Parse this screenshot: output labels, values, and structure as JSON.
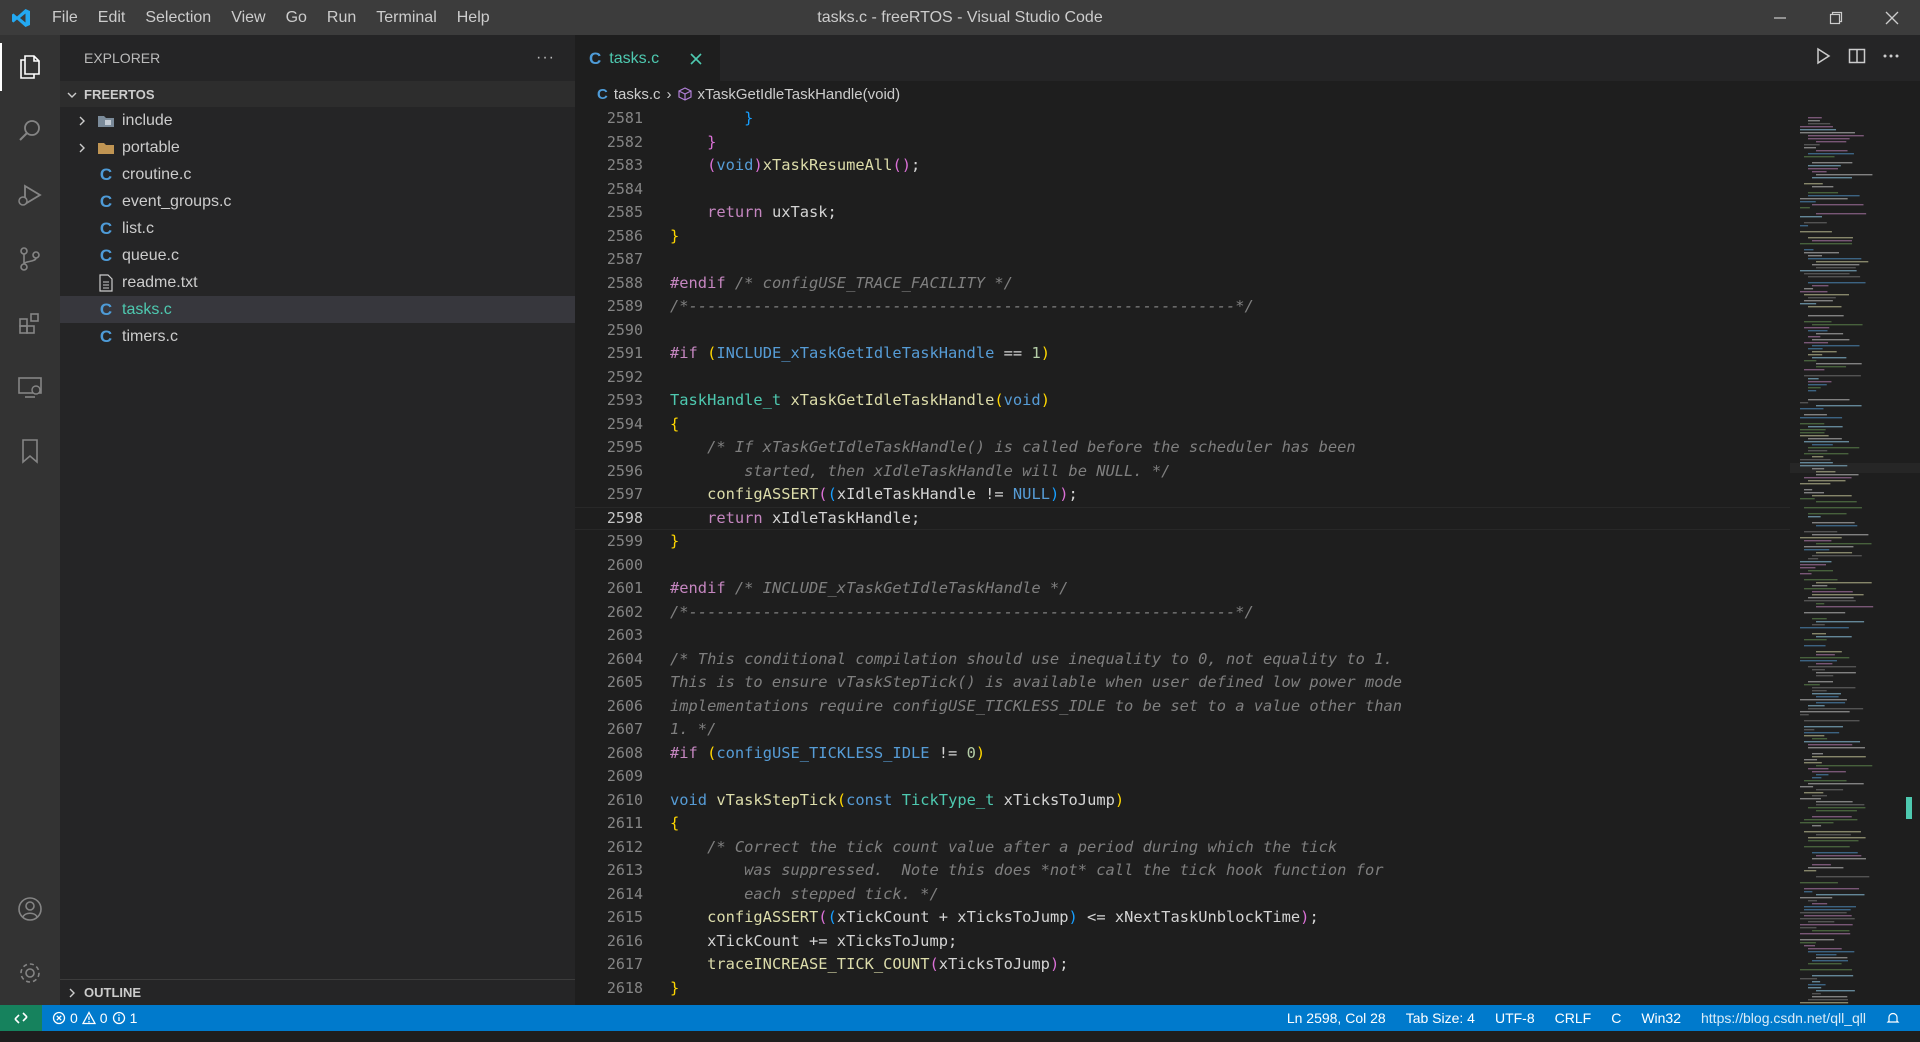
{
  "window": {
    "title": "tasks.c - freeRTOS - Visual Studio Code"
  },
  "menu": [
    "File",
    "Edit",
    "Selection",
    "View",
    "Go",
    "Run",
    "Terminal",
    "Help"
  ],
  "sidebar": {
    "header": "EXPLORER",
    "more": "···",
    "root": "FREERTOS",
    "items": [
      {
        "label": "include",
        "kind": "folder"
      },
      {
        "label": "portable",
        "kind": "folder"
      },
      {
        "label": "croutine.c",
        "kind": "c"
      },
      {
        "label": "event_groups.c",
        "kind": "c"
      },
      {
        "label": "list.c",
        "kind": "c"
      },
      {
        "label": "queue.c",
        "kind": "c"
      },
      {
        "label": "readme.txt",
        "kind": "txt"
      },
      {
        "label": "tasks.c",
        "kind": "c",
        "selected": true
      },
      {
        "label": "timers.c",
        "kind": "c"
      }
    ],
    "outline": "OUTLINE"
  },
  "editor": {
    "tab_label": "tasks.c",
    "breadcrumb": {
      "file": "tasks.c",
      "symbol": "xTaskGetIdleTaskHandle(void)"
    },
    "line_numbers": [
      "2581",
      "2582",
      "2583",
      "2584",
      "2585",
      "2586",
      "2587",
      "2588",
      "2589",
      "2590",
      "2591",
      "2592",
      "2593",
      "2594",
      "2595",
      "2596",
      "2597",
      "2598",
      "2599",
      "2600",
      "2601",
      "2602",
      "2603",
      "2604",
      "2605",
      "2606",
      "2607",
      "2608",
      "2609",
      "2610",
      "2611",
      "2612",
      "2613",
      "2614",
      "2615",
      "2616",
      "2617",
      "2618"
    ],
    "current_line": "2598"
  },
  "status": {
    "errors": "0",
    "warnings": "0",
    "info": "1",
    "position": "Ln 2598, Col 28",
    "tab_size": "Tab Size: 4",
    "encoding": "UTF-8",
    "eol": "CRLF",
    "language": "C",
    "platform": "Win32",
    "watermark": "https://blog.csdn.net/qll_qll"
  },
  "colors": {
    "accent": "#007acc",
    "remote": "#16825d",
    "activity_bar": "#333333",
    "sidebar": "#252526",
    "editor_bg": "#1e1e1e"
  }
}
